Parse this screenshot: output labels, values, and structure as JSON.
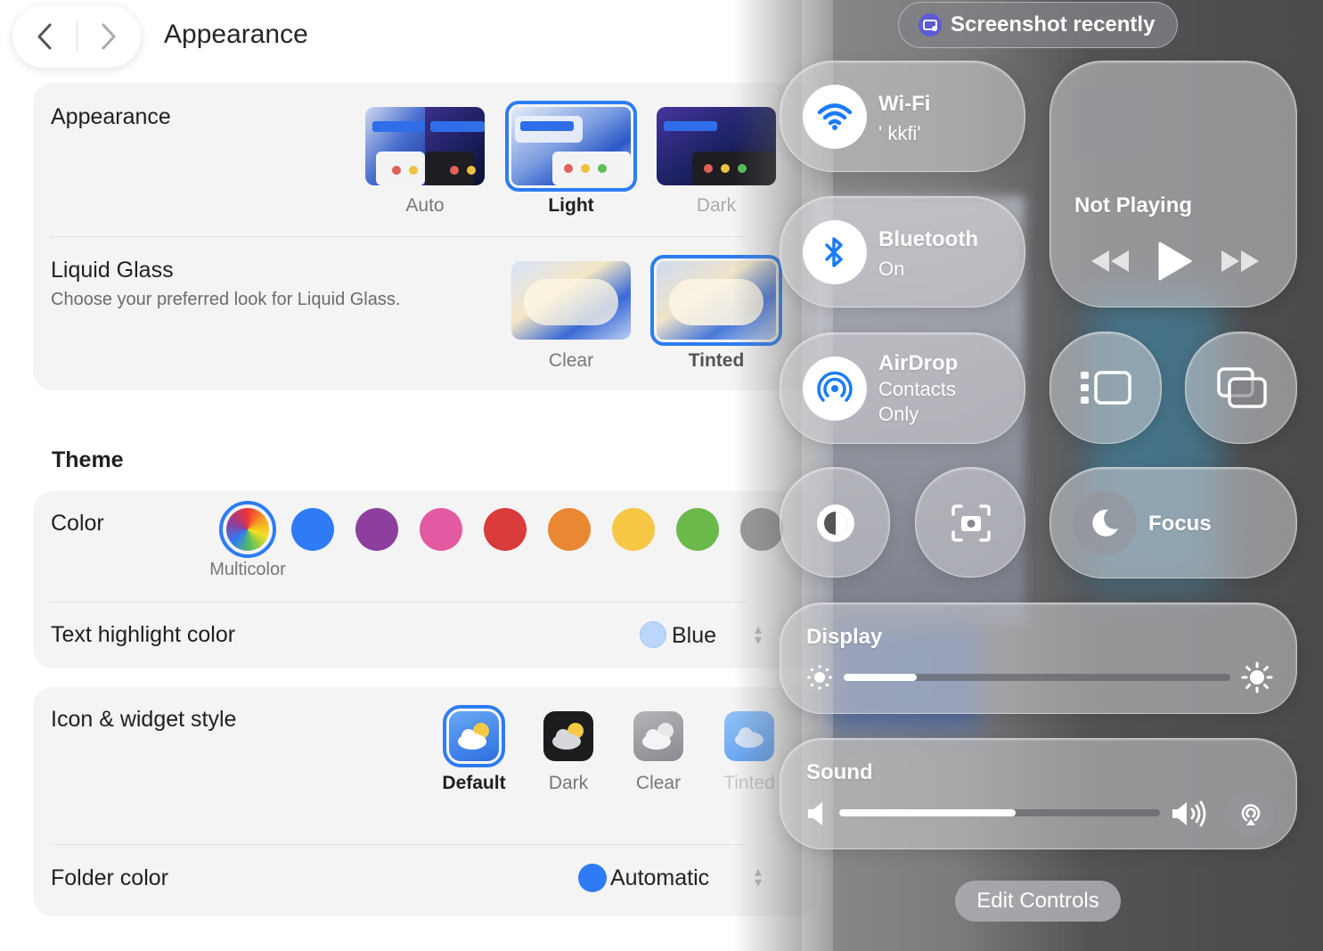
{
  "nav": {
    "back": "‹",
    "forward": "›"
  },
  "page_title": "Appearance",
  "appearance": {
    "label": "Appearance",
    "options": [
      {
        "label": "Auto",
        "selected": false
      },
      {
        "label": "Light",
        "selected": true
      },
      {
        "label": "Dark",
        "selected": false
      }
    ]
  },
  "liquid_glass": {
    "label": "Liquid Glass",
    "description": "Choose your preferred look for Liquid Glass.",
    "options": [
      {
        "label": "Clear",
        "selected": false
      },
      {
        "label": "Tinted",
        "selected": true
      }
    ]
  },
  "theme_heading": "Theme",
  "color": {
    "label": "Color",
    "selected_name": "Multicolor",
    "swatches": [
      "#multicolor",
      "#2f7bf5",
      "#8e3f9e",
      "#e45aa2",
      "#d93a3a",
      "#ea8733",
      "#f5c744",
      "#6bb84b",
      "#9b9b9b"
    ]
  },
  "text_highlight": {
    "label": "Text highlight color",
    "value": "Blue",
    "swatch": "#bcd6fb"
  },
  "icon_widget": {
    "label": "Icon & widget style",
    "options": [
      {
        "label": "Default",
        "selected": true
      },
      {
        "label": "Dark",
        "selected": false
      },
      {
        "label": "Clear",
        "selected": false
      },
      {
        "label": "Tinted",
        "selected": false
      }
    ]
  },
  "folder_color": {
    "label": "Folder color",
    "value": "Automatic",
    "swatch": "#2f7bf5"
  },
  "control_center": {
    "screenshot_pill": "Screenshot recently",
    "wifi": {
      "title": "Wi-Fi",
      "sub": "' kkfi'"
    },
    "bluetooth": {
      "title": "Bluetooth",
      "sub": "On"
    },
    "airdrop": {
      "title": "AirDrop",
      "sub1": "Contacts",
      "sub2": "Only"
    },
    "now_playing": {
      "status": "Not Playing"
    },
    "focus": {
      "label": "Focus"
    },
    "display": {
      "label": "Display",
      "brightness": 0.19
    },
    "sound": {
      "label": "Sound",
      "volume": 0.55
    },
    "edit_controls": "Edit Controls"
  },
  "colors": {
    "accent": "#2d7cf6"
  }
}
